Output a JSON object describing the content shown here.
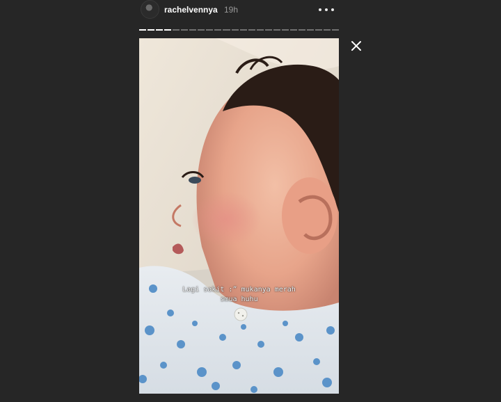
{
  "header": {
    "username": "rachelvennya",
    "timestamp": "19h"
  },
  "icons": {
    "more": "more-horizontal-icon",
    "close": "close-icon"
  },
  "progress": {
    "segments_total": 24,
    "segments_done": 4
  },
  "story": {
    "caption_line1": "Lagi sakit :” mukanya merah",
    "caption_line2": "smua huhu"
  },
  "colors": {
    "background": "#262626",
    "text": "#ffffff",
    "muted": "#9a9a9a"
  }
}
